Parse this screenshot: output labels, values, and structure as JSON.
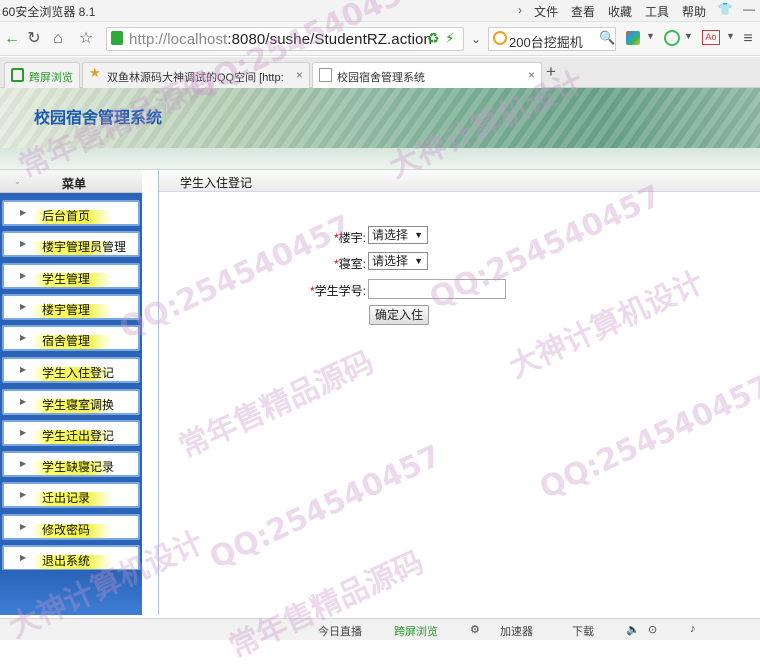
{
  "browser": {
    "app_title": "60安全浏览器 8.1",
    "menus": [
      "文件",
      "查看",
      "收藏",
      "工具",
      "帮助"
    ],
    "url_host": "http://localhost",
    "url_rest": ":8080/sushe/StudentRZ.action",
    "search_text": "200台挖掘机",
    "tabs": [
      {
        "label": "跨屏浏览"
      },
      {
        "label": "双鱼林源码大神调试的QQ空间 [http:",
        "close": "×"
      },
      {
        "label": "校园宿舍管理系统",
        "close": "×"
      }
    ],
    "new_tab": "+",
    "status_items": [
      "今日直播",
      "跨屏浏览",
      "加速器",
      "下载"
    ]
  },
  "page": {
    "system_title": "校园宿舍管理系统",
    "menu_title": "菜单",
    "content_title": "学生入住登记"
  },
  "sidebar": {
    "items": [
      {
        "label": "后台首页"
      },
      {
        "label": "楼宇管理员管理"
      },
      {
        "label": "学生管理"
      },
      {
        "label": "楼宇管理"
      },
      {
        "label": "宿舍管理"
      },
      {
        "label": "学生入住登记"
      },
      {
        "label": "学生寝室调换"
      },
      {
        "label": "学生迁出登记"
      },
      {
        "label": "学生缺寝记录"
      },
      {
        "label": "迁出记录"
      },
      {
        "label": "修改密码"
      },
      {
        "label": "退出系统"
      }
    ]
  },
  "form": {
    "required_mark": "*",
    "building_label": "楼宇:",
    "building_value": "请选择",
    "room_label": "寝室:",
    "room_value": "请选择",
    "student_label": "学生学号:",
    "student_value": "",
    "submit_label": "确定入住"
  },
  "watermarks": [
    "QQ:254540457",
    "大神计算机设计",
    "常年售精品源码"
  ]
}
